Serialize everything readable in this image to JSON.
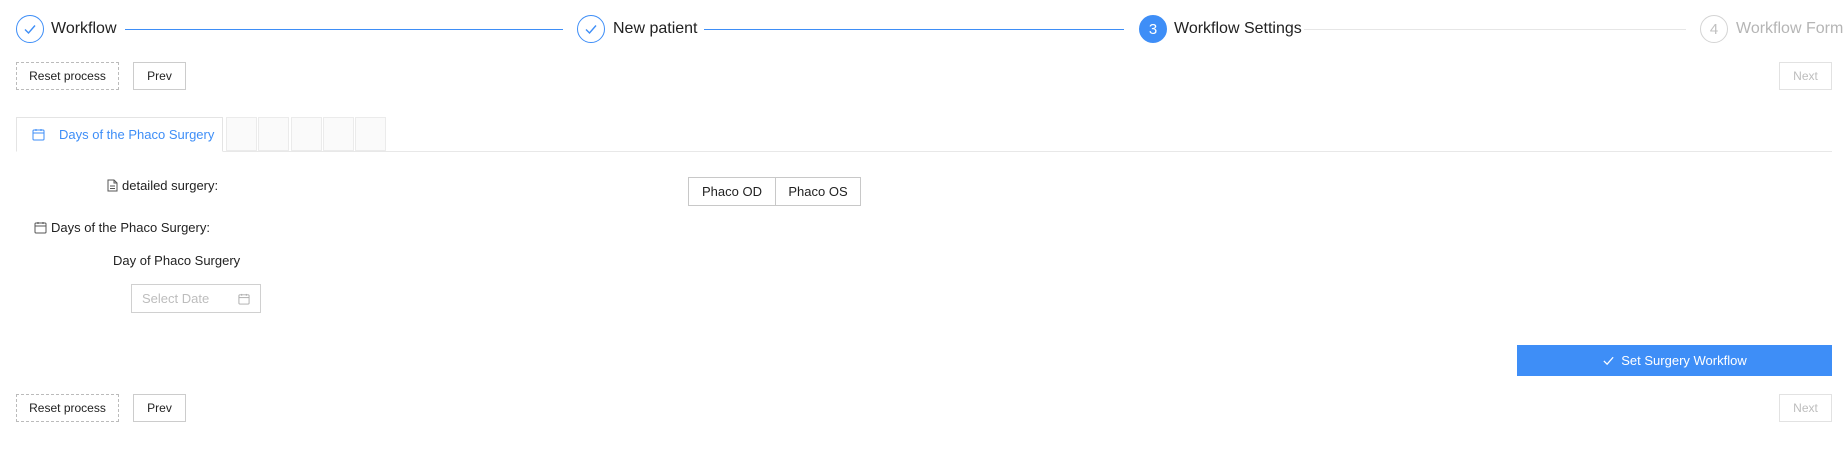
{
  "steps": [
    {
      "number": "1",
      "title": "Workflow",
      "state": "done"
    },
    {
      "number": "2",
      "title": "New patient",
      "state": "done"
    },
    {
      "number": "3",
      "title": "Workflow Settings",
      "state": "active"
    },
    {
      "number": "4",
      "title": "Workflow Form",
      "state": "pending"
    }
  ],
  "nav_top": {
    "reset": "Reset process",
    "prev": "Prev",
    "next": "Next"
  },
  "tabs": {
    "active_label": "Days of the Phaco Surgery"
  },
  "form": {
    "detailed_surgery_label": "detailed surgery:",
    "surgery_options": [
      "Phaco OD",
      "Phaco OS"
    ],
    "days_label": "Days of the Phaco Surgery:",
    "day_label": "Day of Phaco Surgery",
    "date_placeholder": "Select Date"
  },
  "submit_label": "Set Surgery Workflow",
  "nav_bottom": {
    "reset": "Reset process",
    "prev": "Prev",
    "next": "Next"
  },
  "colors": {
    "accent": "#3e8ef7",
    "border": "#d0d0d0",
    "disabled": "#bdbdbd"
  }
}
